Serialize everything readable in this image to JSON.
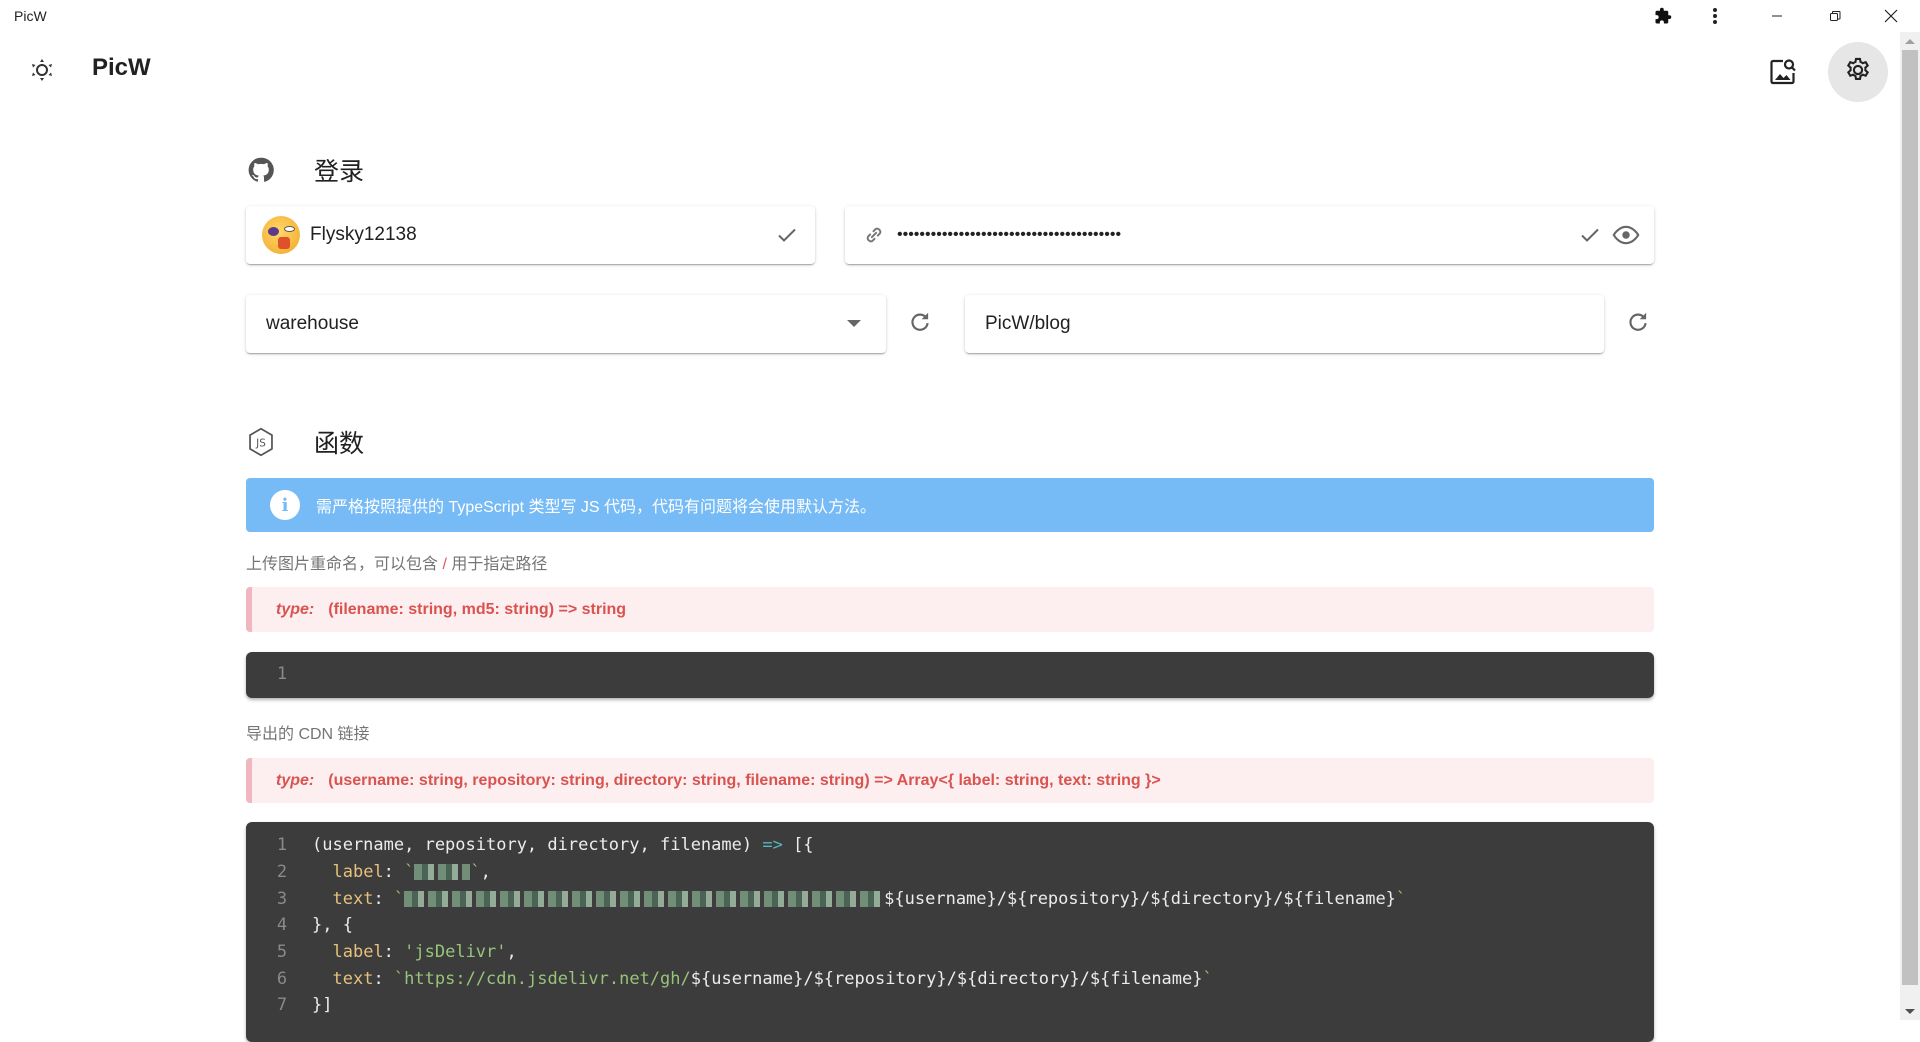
{
  "window": {
    "title": "PicW",
    "controls": {
      "extension_icon": "puzzle-icon",
      "menu_icon": "more-vert-icon",
      "minimize": "minimize-icon",
      "restore": "restore-icon",
      "close": "close-icon"
    }
  },
  "appbar": {
    "theme_icon": "brightness-icon",
    "title": "PicW",
    "image_search_icon": "image-search-icon",
    "settings_icon": "gear-icon"
  },
  "login": {
    "title": "登录",
    "icon": "github-icon",
    "username": "Flysky12138",
    "token_masked": "••••••••••••••••••••••••••••••••••••••••",
    "repository_select": "warehouse",
    "directory_value": "PicW/blog"
  },
  "functions": {
    "title": "函数",
    "icon": "nodejs-icon",
    "alert": "需严格按照提供的 TypeScript 类型写 JS 代码，代码有问题将会使用默认方法。",
    "rename": {
      "caption_before": "上传图片重命名，可以包含 ",
      "caption_slash": "/",
      "caption_after": " 用于指定路径",
      "type_label": "type:",
      "type_sig": "(filename: string, md5: string) => string",
      "lines": [
        ""
      ]
    },
    "cdn": {
      "caption": "导出的 CDN 链接",
      "type_label": "type:",
      "type_sig": "(username: string, repository: string, directory: string, filename: string) => Array<{ label: string, text: string }>",
      "lines": [
        "(username, repository, directory, filename) => [{",
        "  label: `[blurred]`,",
        "  text: `[blurred]${username}/${repository}/${directory}/${filename}`",
        "}, {",
        "  label: 'jsDelivr',",
        "  text: `https://cdn.jsdelivr.net/gh/${username}/${repository}/${directory}/${filename}`",
        "}]"
      ],
      "tokens": {
        "l1_params": "(username, repository, directory, filename)",
        "l1_arrow": " => ",
        "l1_open": "[{",
        "label_key": "label",
        "text_key": "text",
        "colon": ": ",
        "backtick": "`",
        "comma": ",",
        "tpl_vars": "${username}/${repository}/${directory}/${filename}",
        "l4": "}, {",
        "l5_value": "'jsDelivr'",
        "l6_prefix": "https://cdn.jsdelivr.net/gh/",
        "l7": "}]"
      }
    }
  }
}
